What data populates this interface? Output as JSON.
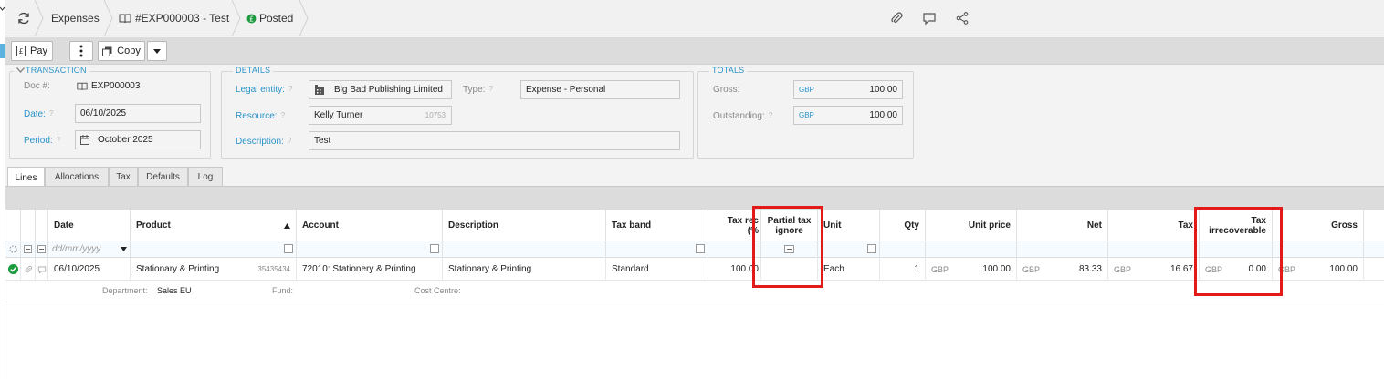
{
  "breadcrumb": {
    "module": "Expenses",
    "record": "#EXP000003 - Test",
    "status": "Posted"
  },
  "toolbar": {
    "pay_label": "Pay",
    "copy_label": "Copy"
  },
  "transaction": {
    "legend": "TRANSACTION",
    "doc_label": "Doc #:",
    "doc_value": "EXP000003",
    "date_label": "Date:",
    "date_value": "06/10/2025",
    "period_label": "Period:",
    "period_value": "October 2025"
  },
  "details": {
    "legend": "DETAILS",
    "legal_entity_label": "Legal entity:",
    "legal_entity_value": "Big Bad Publishing Limited",
    "type_label": "Type:",
    "type_value": "Expense - Personal",
    "resource_label": "Resource:",
    "resource_value": "Kelly Turner",
    "resource_code": "10753",
    "description_label": "Description:",
    "description_value": "Test"
  },
  "totals": {
    "legend": "TOTALS",
    "gross_label": "Gross:",
    "gross_currency": "GBP",
    "gross_value": "100.00",
    "outstanding_label": "Outstanding:",
    "outstanding_currency": "GBP",
    "outstanding_value": "100.00"
  },
  "tabs": [
    "Lines",
    "Allocations",
    "Tax",
    "Defaults",
    "Log"
  ],
  "grid": {
    "headers": {
      "date": "Date",
      "product": "Product",
      "account": "Account",
      "description": "Description",
      "tax_band": "Tax band",
      "tax_rec_1": "Tax rec",
      "tax_rec_2": "(%",
      "partial_1": "Partial tax",
      "partial_2": "ignore",
      "unit": "Unit",
      "qty": "Qty",
      "unit_price": "Unit price",
      "net": "Net",
      "tax": "Tax",
      "tax_irr_1": "Tax",
      "tax_irr_2": "irrecoverable",
      "gross": "Gross"
    },
    "filter_date_placeholder": "dd/mm/yyyy",
    "row": {
      "date": "06/10/2025",
      "product": "Stationary & Printing",
      "product_code": "35435434",
      "account": "72010: Stationery & Printing",
      "description": "Stationary & Printing",
      "tax_band": "Standard",
      "tax_rec": "100.00",
      "unit": "Each",
      "qty": "1",
      "currency": "GBP",
      "unit_price": "100.00",
      "net": "83.33",
      "tax": "16.67",
      "tax_irrecoverable": "0.00",
      "gross": "100.00"
    },
    "sub": {
      "department_label": "Department:",
      "department_value": "Sales EU",
      "fund_label": "Fund:",
      "cost_centre_label": "Cost Centre:"
    }
  }
}
